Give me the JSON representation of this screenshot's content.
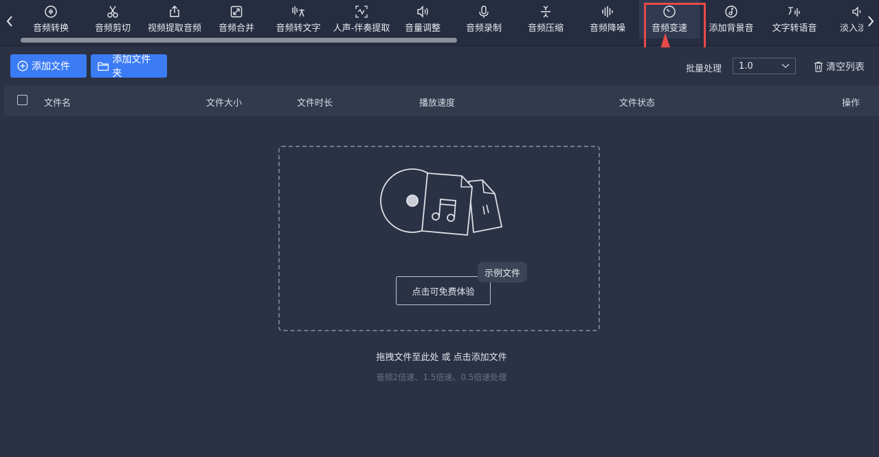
{
  "toolbar": {
    "items": [
      {
        "label": "音频转换",
        "icon": "waveform-circle-icon"
      },
      {
        "label": "音频剪切",
        "icon": "scissors-icon"
      },
      {
        "label": "视频提取音频",
        "icon": "export-icon"
      },
      {
        "label": "音频合并",
        "icon": "merge-icon"
      },
      {
        "label": "音频转文字",
        "icon": "speech-to-text-icon"
      },
      {
        "label": "人声-伴奏提取",
        "icon": "vocal-split-icon"
      },
      {
        "label": "音量调整",
        "icon": "volume-icon"
      },
      {
        "label": "音频录制",
        "icon": "microphone-icon"
      },
      {
        "label": "音频压缩",
        "icon": "compress-icon"
      },
      {
        "label": "音频降噪",
        "icon": "denoise-icon"
      },
      {
        "label": "音频变速",
        "icon": "speedometer-icon",
        "active": true
      },
      {
        "label": "添加背景音",
        "icon": "music-note-circle-icon"
      },
      {
        "label": "文字转语音",
        "icon": "text-to-speech-icon"
      },
      {
        "label": "淡入淡出",
        "icon": "fade-icon"
      }
    ]
  },
  "actions": {
    "add_file": "添加文件",
    "add_folder": "添加文件夹",
    "batch_label": "批量处理",
    "speed_value": "1.0",
    "clear_list": "清空列表"
  },
  "table": {
    "columns": [
      "文件名",
      "文件大小",
      "文件时长",
      "播放速度",
      "文件状态",
      "操作"
    ]
  },
  "dropzone": {
    "try_button": "点击可免费体验",
    "sample_tag": "示例文件",
    "hint": "拖拽文件至此处 或 点击添加文件",
    "subhint": "音频2倍速、1.5倍速、0.5倍速处理"
  },
  "colors": {
    "background": "#2b3246",
    "toolbar": "#262d40",
    "primary": "#3b7cf5",
    "annotation": "#e84a4a"
  }
}
